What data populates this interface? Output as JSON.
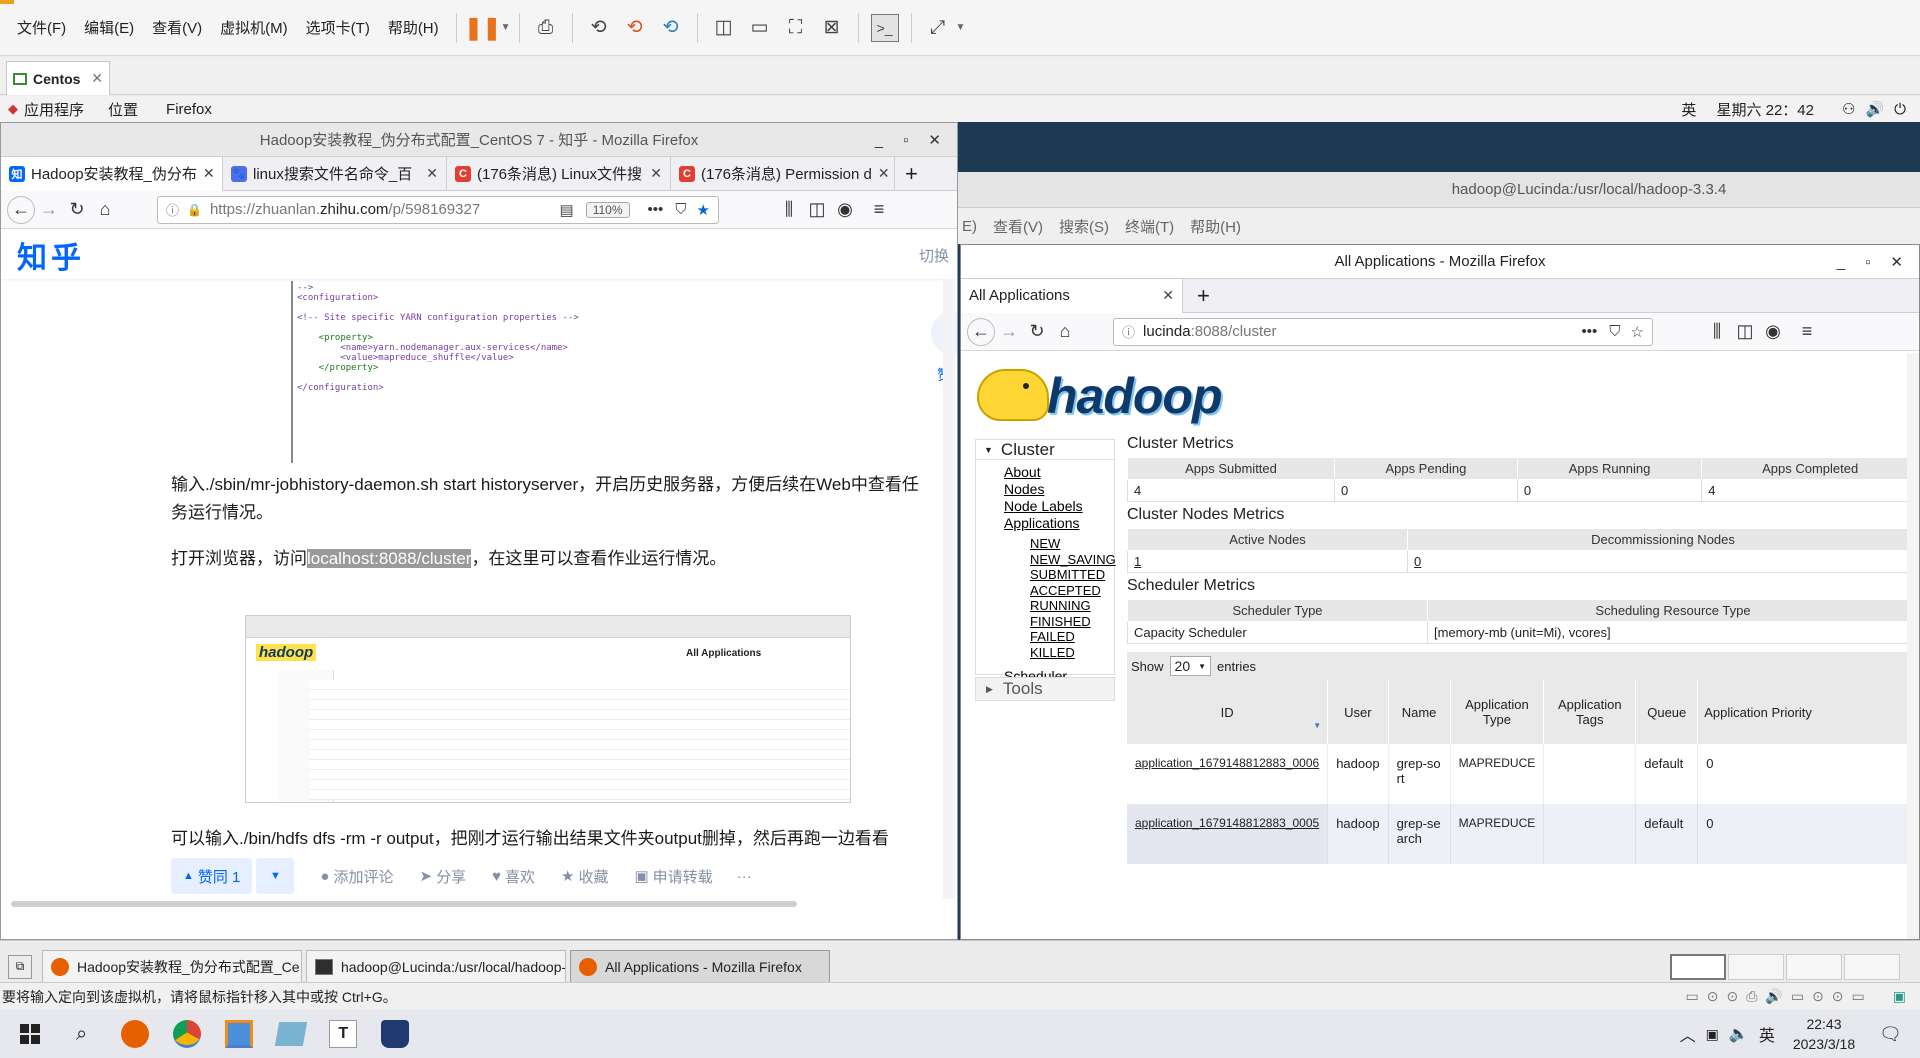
{
  "vmware": {
    "menu": [
      "文件(F)",
      "编辑(E)",
      "查看(V)",
      "虚拟机(M)",
      "选项卡(T)",
      "帮助(H)"
    ],
    "tab_label": "Centos",
    "status_text": "要将输入定向到该虚拟机，请将鼠标指针移入其中或按 Ctrl+G。"
  },
  "gnome": {
    "apps": "应用程序",
    "places": "位置",
    "firefox": "Firefox",
    "ime": "英",
    "clock": "星期六 22：42"
  },
  "zhihu_window": {
    "title": "Hadoop安装教程_伪分布式配置_CentOS 7 - 知乎 - Mozilla Firefox",
    "tabs": [
      {
        "label": "Hadoop安装教程_伪分布",
        "icon": "知",
        "color": "#0066ff"
      },
      {
        "label": "linux搜索文件名命令_百",
        "icon": "🐾",
        "color": "#4e6ef2"
      },
      {
        "label": "(176条消息) Linux文件搜",
        "icon": "C",
        "color": "#e33e33"
      },
      {
        "label": "(176条消息) Permission d",
        "icon": "C",
        "color": "#e33e33"
      }
    ],
    "url_host_pre": "https://zhuanlan.",
    "url_host": "zhihu.com",
    "url_path": "/p/598169327",
    "zoom": "110%",
    "logo": "知乎",
    "switch_label": "切换",
    "side_label": "赞",
    "code_lines": [
      "-->",
      "<configuration>",
      "",
      "<!-- Site specific YARN configuration properties -->",
      "",
      "    <property>",
      "        <name>yarn.nodemanager.aux-services</name>",
      "        <value>mapreduce_shuffle</value>",
      "    </property>",
      "",
      "</configuration>"
    ],
    "para1": "输入./sbin/mr-jobhistory-daemon.sh start historyserver，开启历史服务器，方便后续在Web中查看任务运行情况。",
    "para2_pre": "打开浏览器，访问",
    "para2_hl": "localhost:8088/cluster",
    "para2_post": "，在这里可以查看作业运行情况。",
    "para3": "可以输入./bin/hdfs dfs -rm -r output，把刚才运行输出结果文件夹output删掉，然后再跑一边看看",
    "thumb_title": "All Applications",
    "thumb_logo": "hadoop",
    "actions": {
      "like": "赞同 1",
      "comment": "添加评论",
      "share": "分享",
      "fav": "喜欢",
      "collect": "收藏",
      "report": "申请转载",
      "more": "···"
    }
  },
  "terminal": {
    "title": "hadoop@Lucinda:/usr/local/hadoop-3.3.4",
    "menu": [
      "E)",
      "查看(V)",
      "搜索(S)",
      "终端(T)",
      "帮助(H)"
    ]
  },
  "hadoop_window": {
    "title": "All Applications - Mozilla Firefox",
    "tab": "All Applications",
    "url_host": "lucinda",
    "url_rest": ":8088/cluster",
    "logo_text": "hadoop",
    "cluster_label": "Cluster",
    "nav": [
      "About",
      "Nodes",
      "Node Labels",
      "Applications"
    ],
    "app_states": [
      "NEW",
      "NEW_SAVING",
      "SUBMITTED",
      "ACCEPTED",
      "RUNNING",
      "FINISHED",
      "FAILED",
      "KILLED"
    ],
    "scheduler_link": "Scheduler",
    "tools_label": "Tools",
    "cluster_metrics": {
      "title": "Cluster Metrics",
      "headers": [
        "Apps Submitted",
        "Apps Pending",
        "Apps Running",
        "Apps Completed"
      ],
      "values": [
        "4",
        "0",
        "0",
        "4"
      ]
    },
    "node_metrics": {
      "title": "Cluster Nodes Metrics",
      "headers": [
        "Active Nodes",
        "Decommissioning Nodes"
      ],
      "values": [
        "1",
        "0"
      ]
    },
    "sched_metrics": {
      "title": "Scheduler Metrics",
      "headers": [
        "Scheduler Type",
        "Scheduling Resource Type"
      ],
      "values": [
        "Capacity Scheduler",
        "[memory-mb (unit=Mi), vcores]"
      ]
    },
    "show_label": "Show",
    "show_value": "20",
    "entries_label": "entries",
    "app_headers": [
      "ID",
      "User",
      "Name",
      "Application Type",
      "Application Tags",
      "Queue",
      "Application Priority"
    ],
    "apps": [
      {
        "id": "application_1679148812883_0006",
        "user": "hadoop",
        "name": "grep-sort",
        "type": "MAPREDUCE",
        "tags": "",
        "queue": "default",
        "priority": "0"
      },
      {
        "id": "application_1679148812883_0005",
        "user": "hadoop",
        "name": "grep-search",
        "type": "MAPREDUCE",
        "tags": "",
        "queue": "default",
        "priority": "0"
      }
    ]
  },
  "guest_taskbar": [
    {
      "label": "Hadoop安装教程_伪分布式配置_Ce…",
      "icon": "firefox-icon"
    },
    {
      "label": "hadoop@Lucinda:/usr/local/hadoop-…",
      "icon": "terminal-icon"
    },
    {
      "label": "All Applications - Mozilla Firefox",
      "icon": "firefox-icon"
    }
  ],
  "windows": {
    "ime": "英",
    "time": "22:43",
    "date": "2023/3/18"
  }
}
